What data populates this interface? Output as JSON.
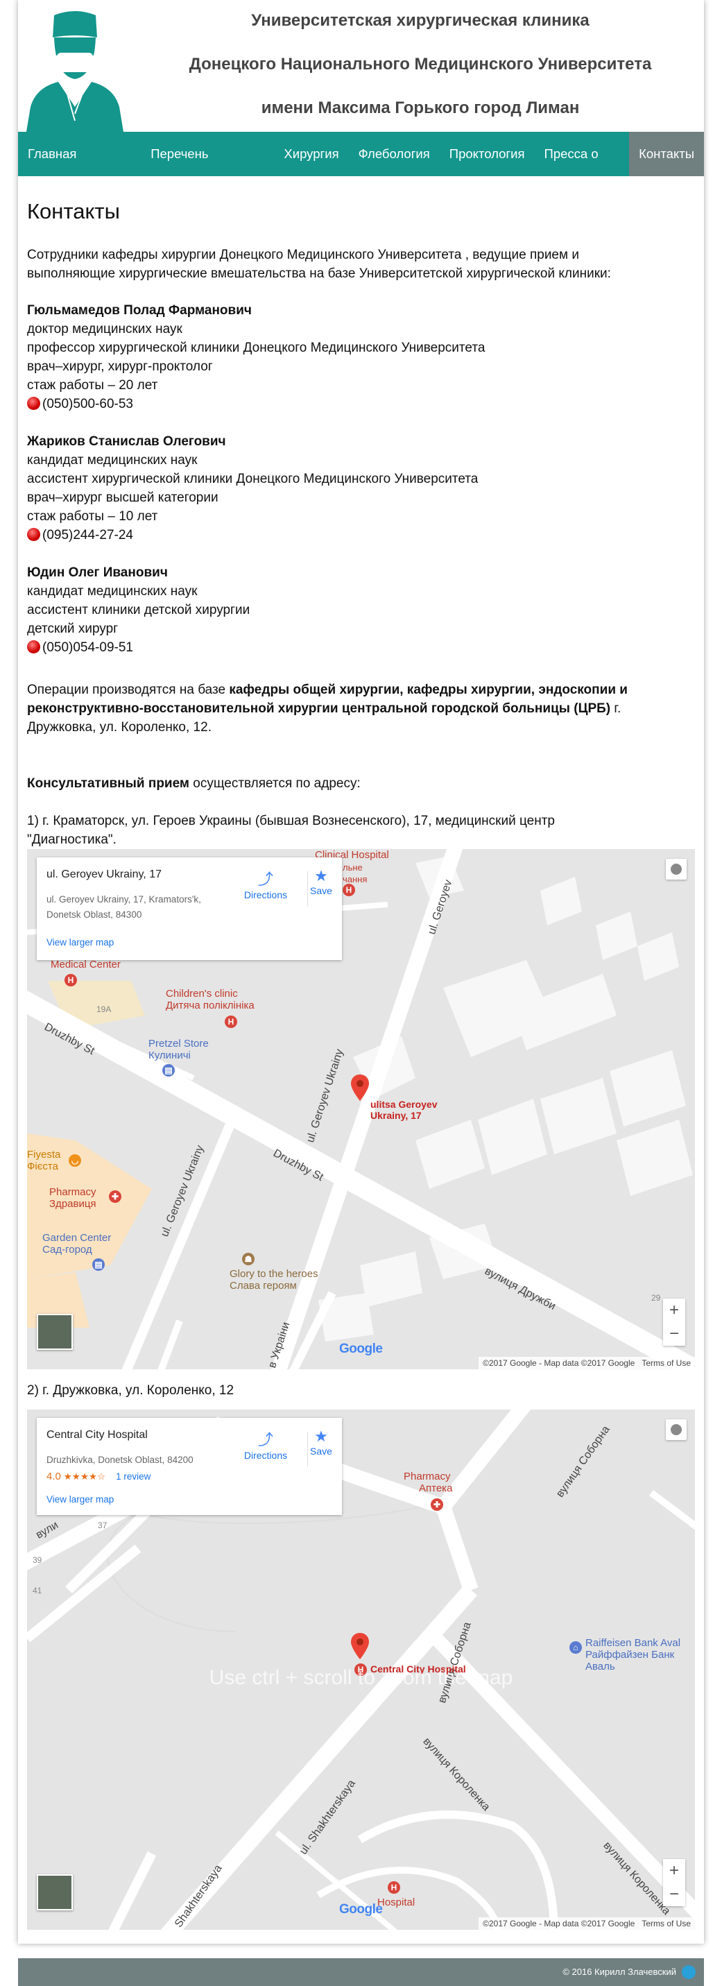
{
  "header": {
    "line1": "Университетская хирургическая клиника",
    "line2": "Донецкого Национального Медицинского Университета",
    "line3": "имени Максима Горького город Лиман"
  },
  "nav": {
    "items": [
      {
        "label": "Главная страница"
      },
      {
        "label": "Перечень операций"
      },
      {
        "label": "Хирургия"
      },
      {
        "label": "Флебология"
      },
      {
        "label": "Проктология"
      },
      {
        "label": "Пресса о нас"
      },
      {
        "label": "Контакты"
      }
    ],
    "active": "Контакты"
  },
  "content": {
    "title": "Контакты",
    "intro1": "Сотрудники кафедры хирургии Донецкого Медицинского Университета , ведущие прием и",
    "intro2": "выполняющие хирургические вмешательства на базе Университетской хирургической клиники:",
    "doctors": [
      {
        "name": "Гюльмамедов Полад Фарманович",
        "lines": [
          "доктор медицинских наук",
          "профессор хирургической клиники Донецкого Медицинского Университета",
          "врач–хирург, хирург-проктолог",
          "стаж работы – 20 лет"
        ],
        "phone": "(050)500-60-53"
      },
      {
        "name": "Жариков Станислав Олегович",
        "lines": [
          "кандидат медицинских наук",
          "ассистент хирургической клиники Донецкого Медицинского Университета",
          "врач–хирург высшей категории",
          "стаж работы – 10 лет"
        ],
        "phone": "(095)244-27-24"
      },
      {
        "name": "Юдин Олег Иванович",
        "lines": [
          "кандидат медицинских наук",
          "ассистент клиники детской хирургии",
          "детский хирург"
        ],
        "phone": "(050)054-09-51"
      }
    ],
    "ops_prefix": "Операции производятся на базе ",
    "ops_bold1": "кафедры общей хирургии, кафедры хирургии, эндоскопии и",
    "ops_bold2": "реконструктивно-восстановительной хирургии центральной городской больницы (ЦРБ)",
    "ops_suffix": " г.",
    "ops_line3": "Дружковка, ул. Короленко, 12.",
    "consult_bold": "Консультативный прием",
    "consult_rest": " осуществляется по адресу:",
    "addr1_line1": "1) г. Краматорск, ул. Героев Украины (бывшая Вознесенского), 17, медицинский центр",
    "addr1_line2": "\"Диагностика\".",
    "addr2": "2) г. Дружковка, ул. Короленко, 12"
  },
  "map1": {
    "card_title": "ul. Geroyev Ukrainy, 17",
    "card_addr1": "ul. Geroyev Ukrainy, 17, Kramators'k,",
    "card_addr2": "Donetsk Oblast, 84300",
    "directions": "Directions",
    "save": "Save",
    "larger": "View larger map",
    "pin_label1": "ulitsa Geroyev",
    "pin_label2": "Ukrainy, 17",
    "pois": {
      "clinical": "Clinical Hospital",
      "clinical_uk1": "льне",
      "clinical_uk2": "чання",
      "medical": "Medical Center",
      "children1": "Children's clinic",
      "children2": "Дитяча поліклініка",
      "pretzel1": "Pretzel Store",
      "pretzel2": "Кулиничі",
      "fiyesta1": "Fiyesta",
      "fiyesta2": "Фієста",
      "pharmacy1": "Pharmacy",
      "pharmacy2": "Здравиця",
      "garden1": "Garden Center",
      "garden2": "Сад-город",
      "glory1": "Glory to the heroes",
      "glory2": "Слава героям",
      "num19a": "19A",
      "num29": "29"
    },
    "roads": {
      "druzhby1": "Druzhby St",
      "druzhby2": "Druzhby St",
      "druzhby_uk": "вулиця Дружби",
      "geroyev1": "ul. Geroyev Ukrainy",
      "geroyev2": "ul. Geroyev Ukrainy",
      "geroyev3": "ul. Geroyev",
      "ukrainy": "в Украіни"
    },
    "google": "Google",
    "attribution": "©2017 Google - Map data ©2017 Google",
    "terms": "Terms of Use"
  },
  "map2": {
    "card_title": "Central City Hospital",
    "card_addr": "Druzhkivka, Donetsk Oblast, 84200",
    "rating": "4.0",
    "stars": "★★★★☆",
    "reviews": "1 review",
    "directions": "Directions",
    "save": "Save",
    "larger": "View larger map",
    "pin_label": "Central City Hospital",
    "overlay": "Use ctrl + scroll to zoom the map",
    "pois": {
      "pharmacy1": "Pharmacy",
      "pharmacy2": "Аптека",
      "bank1": "Raiffeisen Bank Aval",
      "bank2": "Райффайзен Банк Аваль",
      "hospital": "Hospital",
      "n37": "37",
      "n39": "39",
      "n41": "41"
    },
    "roads": {
      "sobornaya1": "вулиця Соборна",
      "sobornaya2": "вулиця Соборна",
      "korolenka1": "вулиця Короленка",
      "korolenka2": "вулиця Короленка",
      "shakh1": "ul. Shakhterskaya",
      "shakh2": "Shakhterskaya",
      "vuly": "вули"
    },
    "google": "Google",
    "attribution": "©2017 Google - Map data ©2017 Google",
    "terms": "Terms of Use"
  },
  "footer": {
    "copyright": "© 2016 Кирилл Злачевский"
  },
  "colors": {
    "brand": "#14968c",
    "nav_active": "#707f7f",
    "footer": "#707f7f",
    "phone_icon": "#d00000"
  }
}
